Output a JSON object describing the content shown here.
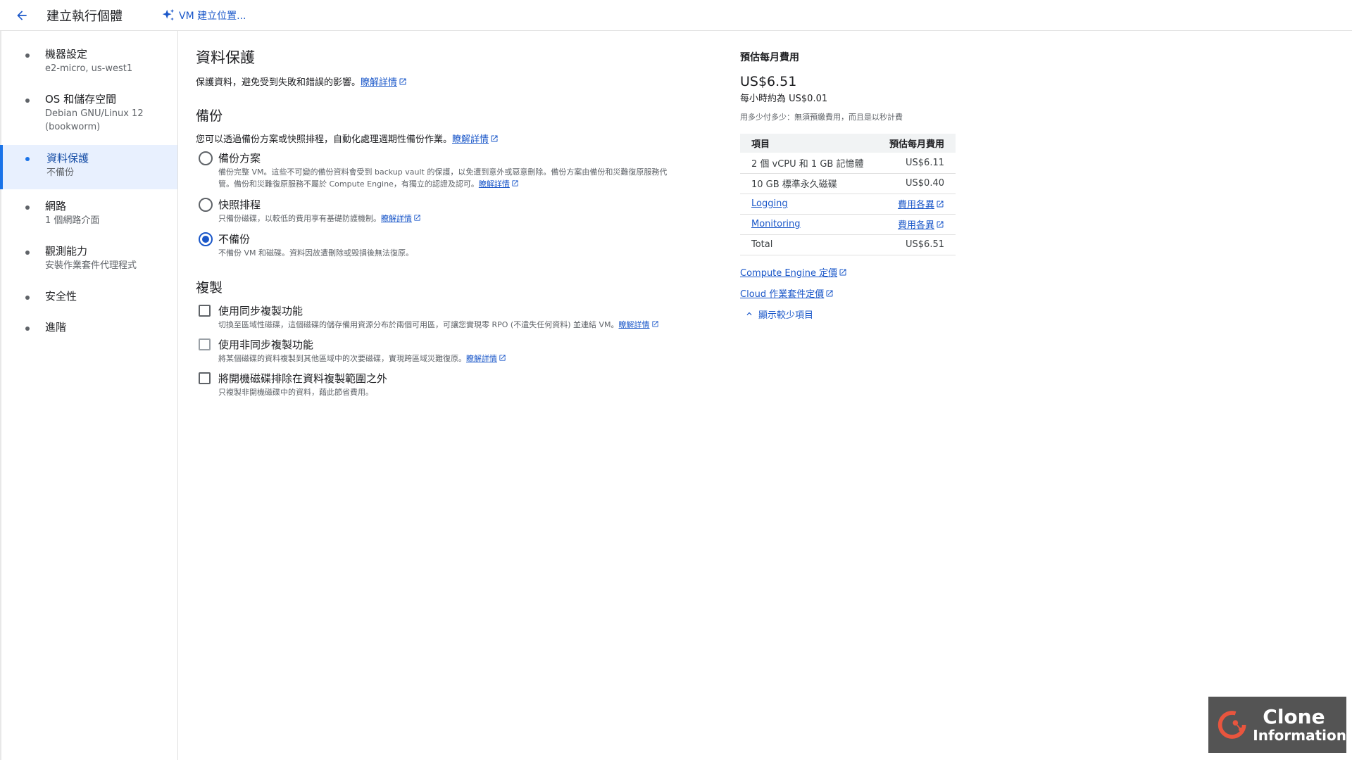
{
  "header": {
    "title": "建立執行個體",
    "vm_location": "VM 建立位置..."
  },
  "nav": {
    "items": [
      {
        "label": "機器設定",
        "sub": "e2-micro, us-west1"
      },
      {
        "label": "OS 和儲存空間",
        "sub": "Debian GNU/Linux 12",
        "sub2": "(bookworm)"
      },
      {
        "label": "資料保護",
        "sub": "不備份"
      },
      {
        "label": "網路",
        "sub": "1 個網路介面"
      },
      {
        "label": "觀測能力",
        "sub": "安裝作業套件代理程式"
      },
      {
        "label": "安全性"
      },
      {
        "label": "進階"
      }
    ]
  },
  "main": {
    "title": "資料保護",
    "desc": "保護資料，避免受到失敗和錯誤的影響。",
    "learn_more": "瞭解詳情",
    "backup": {
      "title": "備份",
      "desc": "您可以透過備份方案或快照排程，自動化處理週期性備份作業。",
      "options": [
        {
          "label": "備份方案",
          "desc_line1": "備份完整 VM。這些不可變的備份資料會受到 backup vault 的保護，以免遭到意外或惡意刪除。備份方案由備份和災難復原服務代",
          "desc_line2": "管。備份和災難復原服務不屬於 Compute Engine，有獨立的認證及認可。"
        },
        {
          "label": "快照排程",
          "desc": "只備份磁碟，以較低的費用享有基礎防護機制。"
        },
        {
          "label": "不備份",
          "desc": "不備份 VM 和磁碟。資料因故遭刪除或毀損後無法復原。"
        }
      ]
    },
    "replication": {
      "title": "複製",
      "options": [
        {
          "label": "使用同步複製功能",
          "desc": "切換至區域性磁碟，這個磁碟的儲存備用資源分布於兩個可用區，可讓您實現零 RPO (不遺失任何資料) 並連結 VM。"
        },
        {
          "label": "使用非同步複製功能",
          "desc": "將某個磁碟的資料複製到其他區域中的次要磁碟，實現跨區域災難復原。"
        },
        {
          "label": "將開機磁碟排除在資料複製範圍之外",
          "desc": "只複製非開機磁碟中的資料，藉此節省費用。"
        }
      ]
    }
  },
  "cost": {
    "title": "預估每月費用",
    "total": "US$6.51",
    "hourly": "每小時約為 US$0.01",
    "note": "用多少付多少：無須預繳費用，而且是以秒計費",
    "table": {
      "header": [
        "項目",
        "預估每月費用"
      ],
      "rows": [
        [
          "2 個 vCPU 和 1 GB 記憶體",
          "US$6.11"
        ],
        [
          "10 GB 標準永久磁碟",
          "US$0.40"
        ],
        [
          "Logging",
          "費用各異"
        ],
        [
          "Monitoring",
          "費用各異"
        ],
        [
          "Total",
          "US$6.51"
        ]
      ]
    },
    "links": [
      "Compute Engine 定價",
      "Cloud 作業套件定價"
    ],
    "show_less": "顯示較少項目"
  },
  "watermark": {
    "line1": "Clone",
    "line2": "Information"
  },
  "colors": {
    "accent": "#1a57c9",
    "active_nav_bg": "#e8f0fe"
  }
}
